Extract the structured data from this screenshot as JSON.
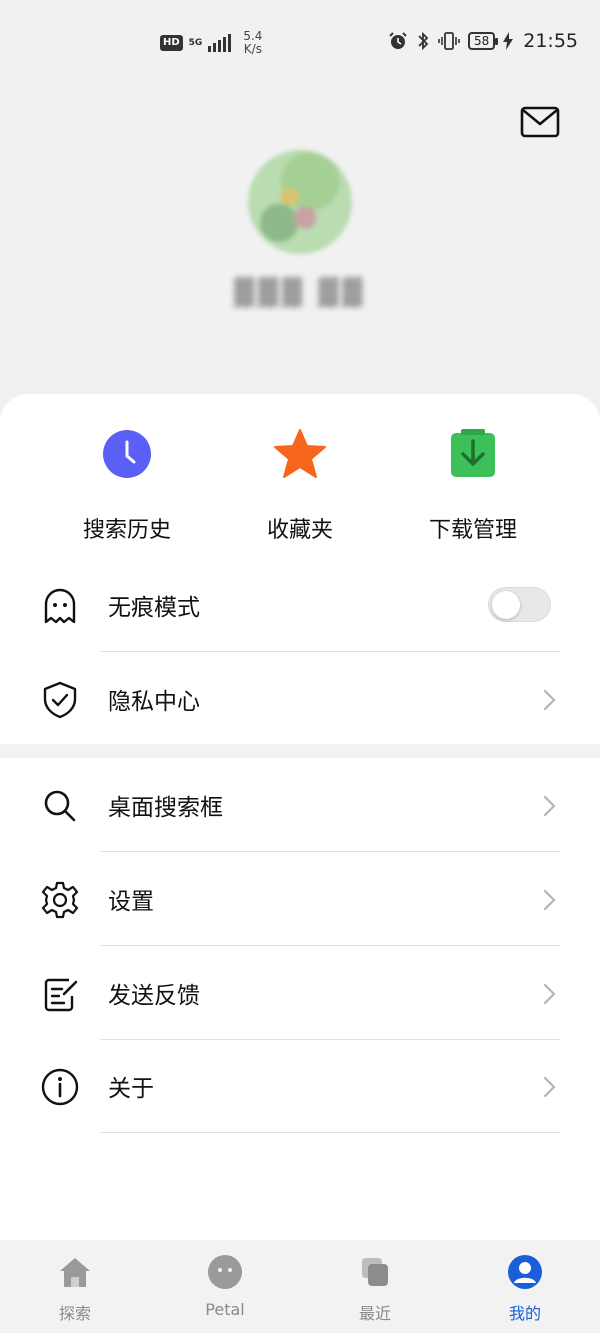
{
  "status_bar": {
    "hd": "HD",
    "network": "5G",
    "speed_value": "5.4",
    "speed_unit": "K/s",
    "battery": "58",
    "time": "21:55",
    "icons": [
      "alarm-icon",
      "bluetooth-icon",
      "vibrate-icon",
      "battery-icon",
      "charging-icon"
    ]
  },
  "header": {
    "mail_icon": "mail-icon"
  },
  "shortcuts": [
    {
      "label": "搜索历史",
      "icon": "clock-icon",
      "color": "#5b5ff5"
    },
    {
      "label": "收藏夹",
      "icon": "star-icon",
      "color": "#f8661e"
    },
    {
      "label": "下载管理",
      "icon": "download-icon",
      "color": "#3cc05a"
    }
  ],
  "settings_group_1": [
    {
      "label": "无痕模式",
      "icon": "ghost-icon",
      "control": "toggle",
      "toggle_on": false
    },
    {
      "label": "隐私中心",
      "icon": "shield-check-icon",
      "control": "chevron"
    }
  ],
  "settings_group_2": [
    {
      "label": "桌面搜索框",
      "icon": "search-icon",
      "control": "chevron"
    },
    {
      "label": "设置",
      "icon": "gear-icon",
      "control": "chevron"
    },
    {
      "label": "发送反馈",
      "icon": "feedback-icon",
      "control": "chevron"
    },
    {
      "label": "关于",
      "icon": "info-icon",
      "control": "chevron"
    }
  ],
  "bottom_nav": [
    {
      "label": "探索",
      "icon": "home-icon",
      "active": false
    },
    {
      "label": "Petal",
      "icon": "petal-face-icon",
      "active": false
    },
    {
      "label": "最近",
      "icon": "recent-icon",
      "active": false
    },
    {
      "label": "我的",
      "icon": "profile-icon",
      "active": true
    }
  ],
  "colors": {
    "accent": "#1a5fd9",
    "background": "#f1f1f2",
    "card": "#ffffff",
    "text": "#111111"
  }
}
